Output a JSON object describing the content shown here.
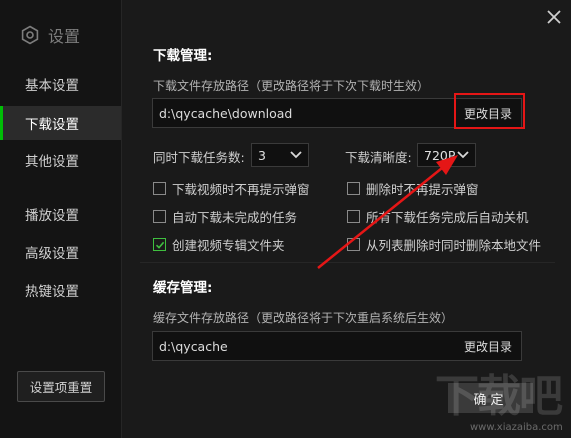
{
  "sidebar": {
    "title": "设置",
    "items": [
      {
        "label": "基本设置",
        "active": false
      },
      {
        "label": "下载设置",
        "active": true
      },
      {
        "label": "其他设置",
        "active": false
      },
      {
        "label": "播放设置",
        "active": false
      },
      {
        "label": "高级设置",
        "active": false
      },
      {
        "label": "热键设置",
        "active": false
      }
    ],
    "reset_label": "设置项重置"
  },
  "download": {
    "title": "下载管理:",
    "path_desc": "下载文件存放路径（更改路径将于下次下载时生效）",
    "path_value": "d:\\qycache\\download",
    "change_label": "更改目录",
    "concurrent_label": "同时下载任务数:",
    "concurrent_value": "3",
    "quality_label": "下载清晰度:",
    "quality_value": "720P",
    "options": [
      {
        "label": "下载视频时不再提示弹窗",
        "checked": false
      },
      {
        "label": "删除时不再提示弹窗",
        "checked": false
      },
      {
        "label": "自动下载未完成的任务",
        "checked": false
      },
      {
        "label": "所有下载任务完成后自动关机",
        "checked": false
      },
      {
        "label": "创建视频专辑文件夹",
        "checked": true
      },
      {
        "label": "从列表删除时同时删除本地文件",
        "checked": false
      }
    ]
  },
  "cache": {
    "title": "缓存管理:",
    "path_desc": "缓存文件存放路径（更改路径将于下次重启系统后生效）",
    "path_value": "d:\\qycache",
    "change_label": "更改目录"
  },
  "footer": {
    "ok_label": "确定"
  },
  "watermark": {
    "logo_text": "下载吧",
    "url": "www.xiazaiba.com"
  },
  "colors": {
    "accent": "#00be06",
    "highlight": "#e51616",
    "background": "#1a1a1a"
  }
}
